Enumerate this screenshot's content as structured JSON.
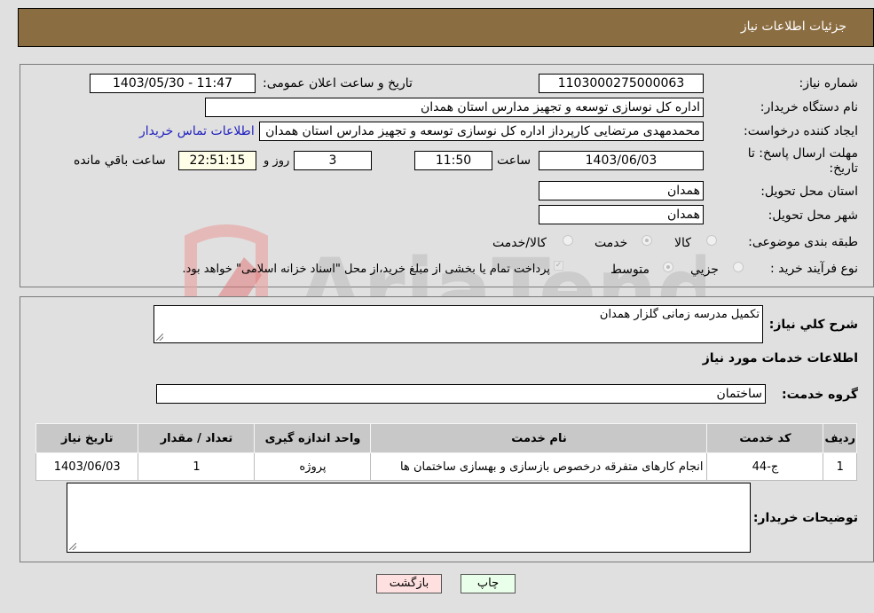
{
  "header": {
    "title": "جزئیات اطلاعات نیاز"
  },
  "form": {
    "need_number": {
      "label": "شماره نیاز:",
      "value": "1103000275000063"
    },
    "announce_datetime": {
      "label": "تاریخ و ساعت اعلان عمومی:",
      "value": "1403/05/30 - 11:47"
    },
    "buyer_org": {
      "label": "نام دستگاه خریدار:",
      "value": "اداره کل نوسازی  توسعه و تجهیز مدارس استان همدان"
    },
    "requester": {
      "label": "ایجاد کننده درخواست:",
      "value": "محمدمهدی مرتضایی کارپرداز اداره کل نوسازی  توسعه و تجهیز مدارس استان همدان"
    },
    "buyer_contact_link": "اطلاعات تماس خریدار",
    "deadline": {
      "label": "مهلت ارسال پاسخ: تا تاریخ:",
      "date": "1403/06/03",
      "time_label": "ساعت",
      "time": "11:50",
      "days": "3",
      "days_label": "روز و",
      "remaining": "22:51:15",
      "remaining_label": "ساعت باقي مانده"
    },
    "delivery_province": {
      "label": "استان محل تحویل:",
      "value": "همدان"
    },
    "delivery_city": {
      "label": "شهر محل تحویل:",
      "value": "همدان"
    },
    "category": {
      "label": "طبقه بندی موضوعی:",
      "options": [
        "کالا",
        "خدمت",
        "کالا/خدمت"
      ],
      "selected": "خدمت"
    },
    "purchase_type": {
      "label": "نوع فرآیند خرید :",
      "options": [
        "جزيي",
        "متوسط"
      ],
      "selected": "متوسط",
      "treasury_note": "پرداخت تمام یا بخشی از مبلغ خرید،از محل \"اسناد خزانه اسلامی\" خواهد بود.",
      "treasury_checked": true
    }
  },
  "details": {
    "summary_label": "شرح کلي نیاز:",
    "summary_value": "تکمیل مدرسه زمانی گلزار همدان",
    "services_heading": "اطلاعات خدمات مورد نیاز",
    "service_group_label": "گروه خدمت:",
    "service_group_value": "ساختمان",
    "table": {
      "headers": [
        "ردیف",
        "کد خدمت",
        "نام خدمت",
        "واحد اندازه گیری",
        "تعداد / مقدار",
        "تاریخ نیاز"
      ],
      "rows": [
        [
          "1",
          "ج-44",
          "انجام کارهای متفرقه درخصوص بازسازی و بهسازی ساختمان ها",
          "پروژه",
          "1",
          "1403/06/03"
        ]
      ]
    },
    "buyer_notes_label": "توضیحات خریدار:",
    "buyer_notes_value": ""
  },
  "buttons": {
    "print": "چاپ",
    "back": "بازگشت"
  },
  "watermark": {
    "text": "AriaTender.neT"
  },
  "colors": {
    "header_bg": "#8b6d42",
    "print_btn_bg": "#eaffea",
    "back_btn_bg": "#ffe0e0",
    "link": "#2020c0"
  }
}
